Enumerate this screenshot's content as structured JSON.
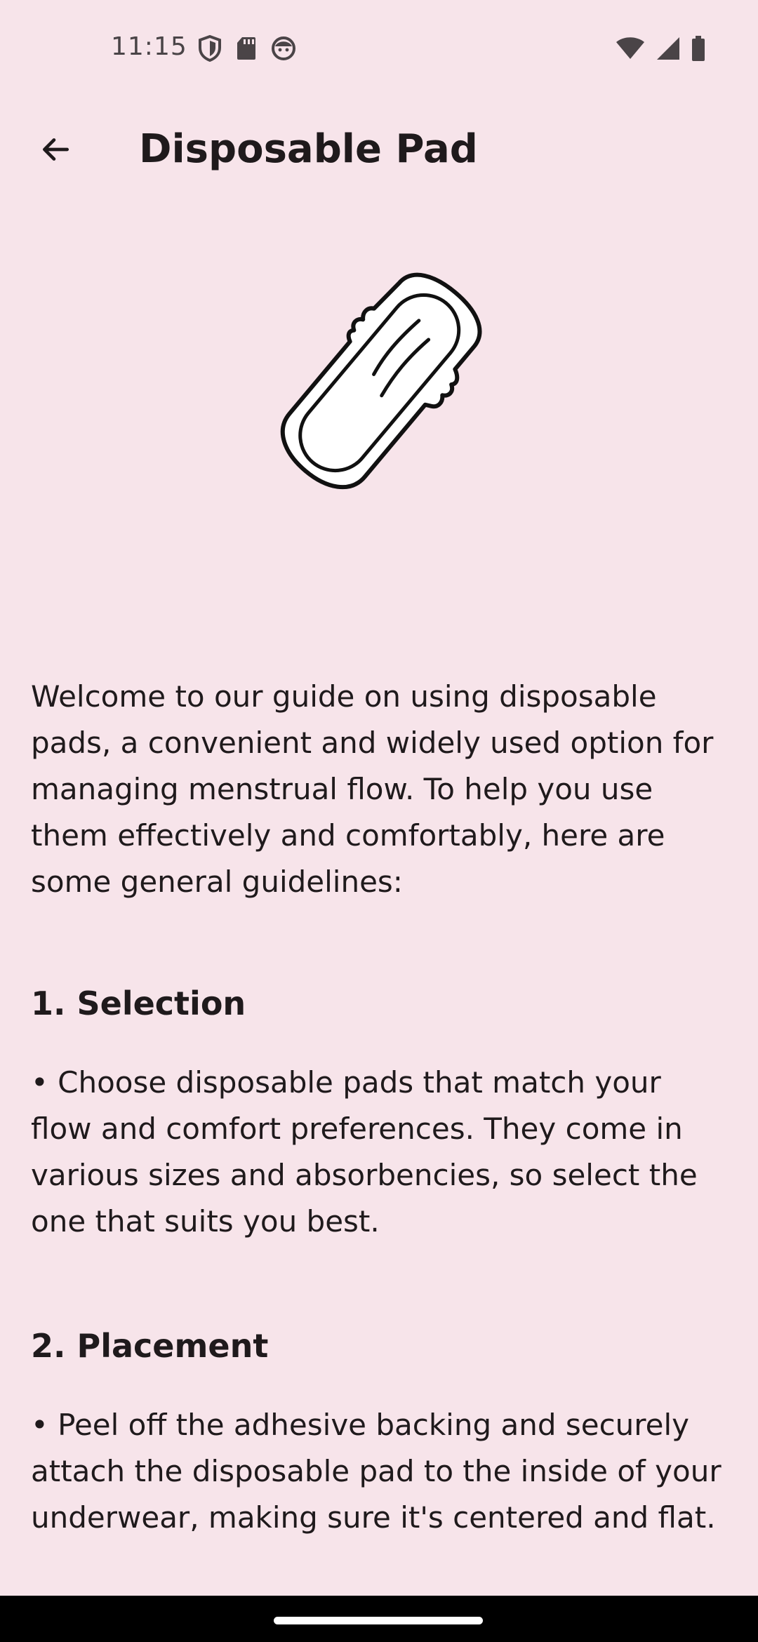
{
  "status_bar": {
    "time": "11:15",
    "left_icons": [
      "shield-icon",
      "sd-card-icon",
      "face-icon"
    ],
    "right_icons": [
      "wifi-icon",
      "cell-signal-icon",
      "battery-icon"
    ]
  },
  "app_bar": {
    "back_icon": "arrow-back-icon",
    "title": "Disposable Pad"
  },
  "illustration": {
    "icon": "disposable-pad-illustration"
  },
  "content": {
    "intro": "Welcome to our guide on using disposable pads, a convenient and widely used option for managing menstrual flow. To help you use them effectively and comfortably, here are some general guidelines:",
    "sections": [
      {
        "heading": "1. Selection",
        "body": "• Choose disposable pads that match your flow and comfort preferences. They come in various sizes and absorbencies, so select the one that suits you best."
      },
      {
        "heading": "2. Placement",
        "body": "• Peel off the adhesive backing and securely attach the disposable pad to the inside of your underwear, making sure it's centered and flat."
      }
    ]
  },
  "colors": {
    "background": "#f7e4ea",
    "text": "#1f1a1c",
    "status_icons": "#4a4447",
    "nav_bar": "#000000"
  }
}
